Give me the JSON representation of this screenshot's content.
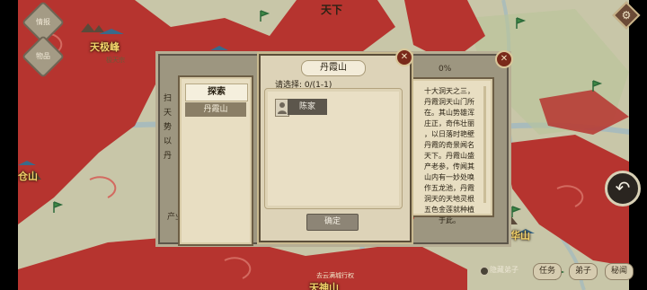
{
  "map": {
    "region_top": "天下",
    "peak_tianji": "天极峰",
    "peak_tianji_sub": "极天宗",
    "cang_mountain": "仓山",
    "hua_mountain": "华山",
    "bottom_region": "天神山",
    "bottom_sub": "去云满城行权",
    "left_label_1": "情报",
    "left_label_2": "物品",
    "note_left": "产业",
    "note_wu": "0%",
    "question_marks": "? ? ?"
  },
  "outer_dialog": {
    "side_text": "扫\n天\n势\n以\n丹"
  },
  "list": {
    "header": "探索",
    "items": [
      "丹霞山"
    ]
  },
  "dialog": {
    "title": "丹霞山",
    "select_label": "请选择: 0/(1-1)",
    "character": "陈家",
    "confirm": "确定",
    "close_symbol": "✕"
  },
  "description": {
    "text": "十大洞天之三，\n丹霞洞天山门所\n在。其山势雄浑\n庄正，奇伟壮丽\n，以日落时艳壁\n丹霞的奇景闻名\n天下。丹霞山盛\n产老参，传闻其\n山内有一妙处唤\n作五龙池，丹霞\n洞天的天地灵根\n五色金莲就种植\n于此。"
  },
  "bottom_bar": {
    "hide_disciples": "隐藏弟子",
    "buttons": [
      "任务",
      "弟子",
      "秘闻"
    ]
  },
  "icons": {
    "return": "return-arrow-icon",
    "settings": "gear-icon",
    "close": "close-icon"
  },
  "colors": {
    "territory_red": "#b6342f",
    "map_land": "#c8c6a8",
    "river": "#8fb2c6",
    "panel_paper": "#e8dec2",
    "dialog_border": "#5b4e39",
    "accent_close": "#7a2a1a"
  }
}
